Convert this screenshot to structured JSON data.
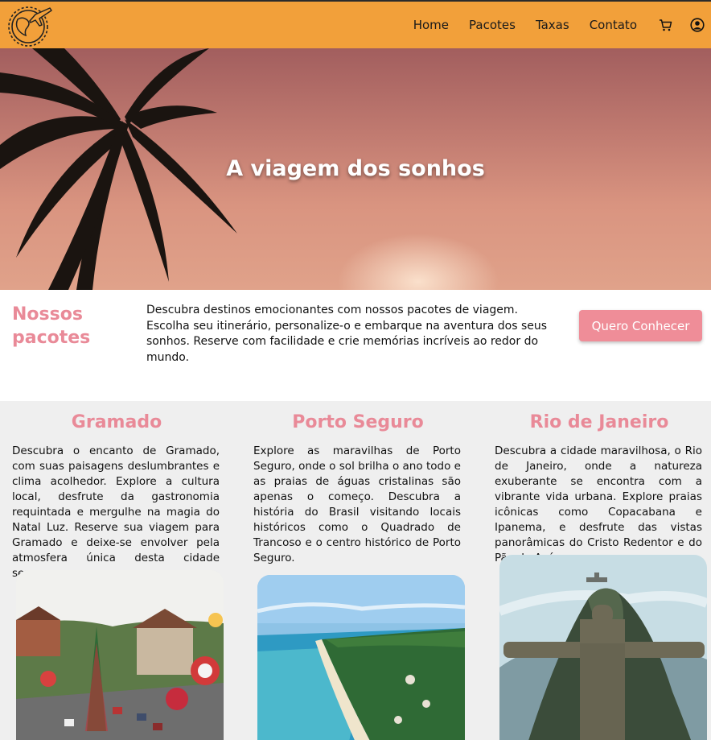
{
  "nav": {
    "links": [
      "Home",
      "Pacotes",
      "Taxas",
      "Contato"
    ],
    "icons": [
      "cart-icon",
      "user-icon"
    ]
  },
  "hero": {
    "title": "A viagem dos sonhos"
  },
  "intro": {
    "title": "Nossos pacotes",
    "text": "Descubra destinos emocionantes com nossos pacotes de viagem. Escolha seu itinerário, personalize-o e embarque na aventura dos seus sonhos. Reserve com facilidade e crie memórias incríveis ao redor do mundo.",
    "button": "Quero Conhecer"
  },
  "packages": [
    {
      "title": "Gramado",
      "text": "Descubra o encanto de Gramado, com suas paisagens deslumbrantes e clima acolhedor. Explore a cultura local, desfrute da gastronomia requintada e mergulhe na magia do Natal Luz. Reserve sua viagem para Gramado e deixe-se envolver pela atmosfera única desta cidade serrana."
    },
    {
      "title": "Porto Seguro",
      "text": "Explore as maravilhas de Porto Seguro, onde o sol brilha o ano todo e as praias de águas cristalinas são apenas o começo. Descubra a história do Brasil visitando locais históricos como o Quadrado de Trancoso e o centro histórico de Porto Seguro."
    },
    {
      "title": "Rio de Janeiro",
      "text": "Descubra a cidade maravilhosa, o Rio de Janeiro, onde a natureza exuberante se encontra com a vibrante vida urbana. Explore praias icônicas como Copacabana e Ipanema, e desfrute das vistas panorâmicas do Cristo Redentor e do Pão de Açúcar."
    }
  ],
  "colors": {
    "header": "#f2a03a",
    "accent": "#e98a98",
    "button": "#ef8d98",
    "section_bg": "#efefef"
  }
}
